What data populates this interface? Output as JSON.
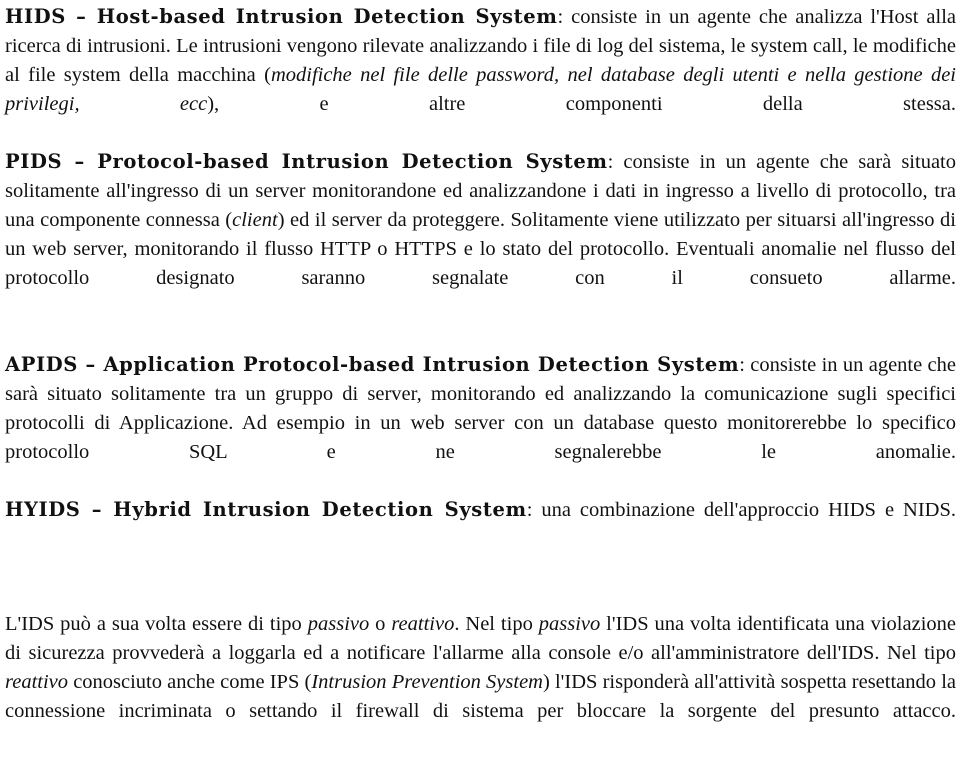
{
  "document": {
    "type": "text-page",
    "language": "it",
    "background_color": "#ffffff",
    "text_color": "#000000",
    "sections": [
      {
        "id": "hids",
        "heading": "HIDS – Host-based Intrusion Detection System",
        "body_1": ": consiste in un agente che analizza l'Host alla ricerca di intrusioni. Le intrusioni vengono rilevate analizzando i file di log del sistema, le system call, le modifiche al file system della macchina (",
        "italic_1": "modifiche nel file delle password, nel database degli utenti e nella gestione dei privilegi, ecc",
        "body_2": "), e altre componenti della stessa."
      },
      {
        "id": "pids",
        "heading": "PIDS – Protocol-based Intrusion Detection System",
        "body_1": ": consiste in un agente che sarà situato solitamente all'ingresso di un server monitorandone ed analizzandone i dati in ingresso a livello di protocollo, tra una componente connessa (",
        "italic_1": "client",
        "body_2": ") ed il server da proteggere. Solitamente viene utilizzato per situarsi all'ingresso di un web server, monitorando il flusso HTTP o HTTPS e lo stato del protocollo. Eventuali anomalie nel flusso del protocollo designato saranno segnalate con il consueto allarme."
      },
      {
        "id": "apids",
        "heading": "APIDS – Application Protocol-based Intrusion Detection System",
        "body_1": ": consiste in un agente che sarà situato solitamente tra un gruppo di server, monitorando ed analizzando la comunicazione sugli specifici protocolli di Applicazione. Ad esempio in un web server con un database questo monitorerebbe lo specifico protocollo SQL e ne segnalerebbe le anomalie."
      },
      {
        "id": "hyids",
        "heading": "HYIDS – Hybrid Intrusion Detection System",
        "body_1": ": una combinazione dell'approccio HIDS e NIDS."
      },
      {
        "id": "closing",
        "body_1": "L'IDS può a sua volta essere di tipo ",
        "italic_1": "passivo",
        "body_2": " o ",
        "italic_2": "reattivo",
        "body_3": ". Nel tipo ",
        "italic_3": "passivo",
        "body_4": " l'IDS una volta identificata una violazione di sicurezza provvederà a loggarla ed a notificare l'allarme alla console e/o all'amministratore dell'IDS. Nel tipo ",
        "italic_4": "reattivo",
        "body_5": " conosciuto anche come IPS (",
        "italic_5": "Intrusion Prevention System",
        "body_6": ") l'IDS risponderà all'attività sospetta resettando la connessione incriminata o settando il firewall di sistema per bloccare la sorgente del presunto attacco."
      }
    ]
  }
}
